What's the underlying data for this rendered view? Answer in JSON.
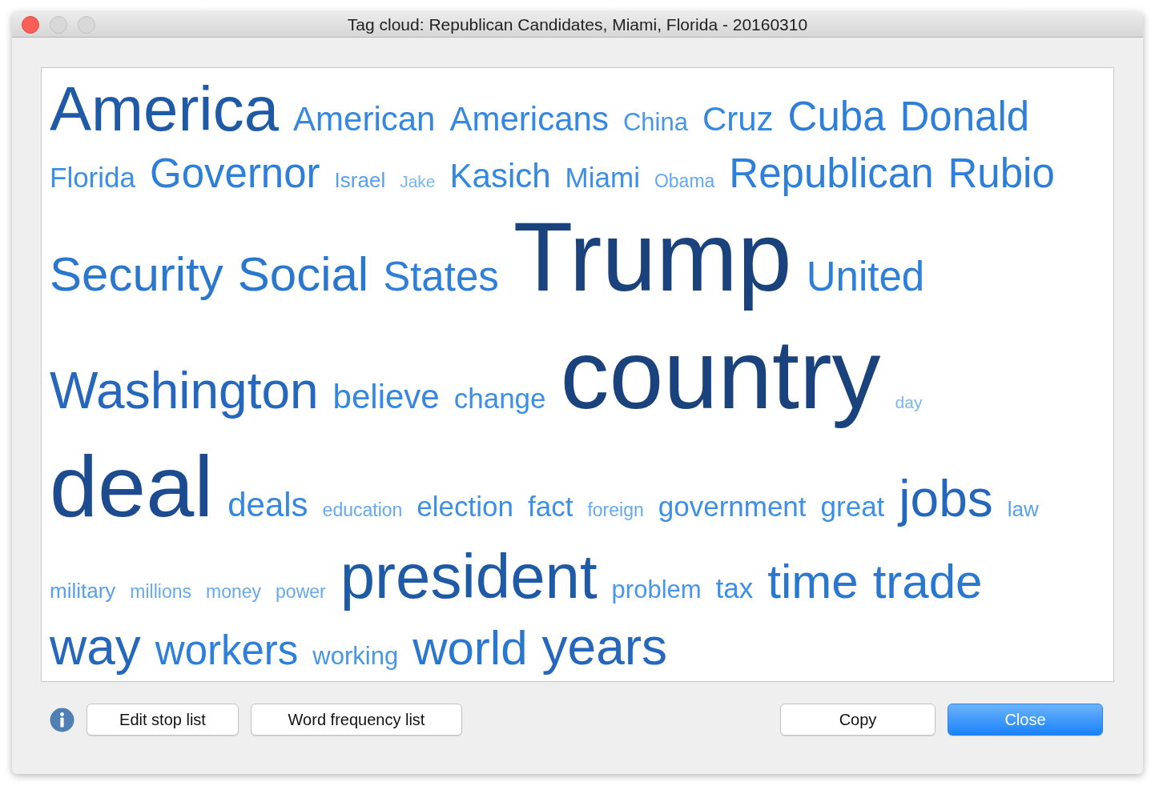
{
  "window": {
    "title": "Tag cloud: Republican Candidates, Miami, Florida - 20160310"
  },
  "cloud": {
    "lines": [
      {
        "words": [
          {
            "text": "America",
            "kind": "t10"
          },
          {
            "text": "American",
            "kind": "t6"
          },
          {
            "text": "Americans",
            "kind": "t6"
          },
          {
            "text": "China",
            "kind": "t4"
          },
          {
            "text": "Cruz",
            "kind": "t6"
          },
          {
            "text": "Cuba",
            "kind": "t7"
          },
          {
            "text": "Donald",
            "kind": "t7"
          }
        ]
      },
      {
        "words": [
          {
            "text": "Florida",
            "kind": "t5"
          },
          {
            "text": "Governor",
            "kind": "t7"
          },
          {
            "text": "Israel",
            "kind": "t3"
          },
          {
            "text": "Jake",
            "kind": "t1"
          },
          {
            "text": "Kasich",
            "kind": "t6"
          },
          {
            "text": "Miami",
            "kind": "t5"
          },
          {
            "text": "Obama",
            "kind": "t2"
          },
          {
            "text": "Republican",
            "kind": "t7"
          },
          {
            "text": "Rubio",
            "kind": "t7"
          }
        ]
      },
      {
        "words": [
          {
            "text": "Security",
            "kind": "t8"
          },
          {
            "text": "Social",
            "kind": "t8"
          },
          {
            "text": "States",
            "kind": "t7"
          },
          {
            "text": "Trump",
            "kind": "t12"
          },
          {
            "text": "United",
            "kind": "t7"
          }
        ]
      },
      {
        "words": [
          {
            "text": "Washington",
            "kind": "t9"
          },
          {
            "text": "believe",
            "kind": "t6"
          },
          {
            "text": "change",
            "kind": "t5"
          },
          {
            "text": "country",
            "kind": "t12"
          },
          {
            "text": "day",
            "kind": "t1"
          }
        ]
      },
      {
        "words": [
          {
            "text": "deal",
            "kind": "t11"
          },
          {
            "text": "deals",
            "kind": "t6"
          },
          {
            "text": "education",
            "kind": "t2"
          },
          {
            "text": "election",
            "kind": "t5"
          },
          {
            "text": "fact",
            "kind": "t5"
          },
          {
            "text": "foreign",
            "kind": "t2"
          },
          {
            "text": "government",
            "kind": "t5"
          },
          {
            "text": "great",
            "kind": "t5"
          },
          {
            "text": "jobs",
            "kind": "t9"
          },
          {
            "text": "law",
            "kind": "t3"
          }
        ]
      },
      {
        "words": [
          {
            "text": "military",
            "kind": "t3"
          },
          {
            "text": "millions",
            "kind": "t2"
          },
          {
            "text": "money",
            "kind": "t2"
          },
          {
            "text": "power",
            "kind": "t2"
          },
          {
            "text": "president",
            "kind": "t10"
          },
          {
            "text": "problem",
            "kind": "t4"
          },
          {
            "text": "tax",
            "kind": "t5"
          },
          {
            "text": "time",
            "kind": "t8"
          },
          {
            "text": "trade",
            "kind": "t8"
          }
        ]
      },
      {
        "words": [
          {
            "text": "way",
            "kind": "t9"
          },
          {
            "text": "workers",
            "kind": "t7"
          },
          {
            "text": "working",
            "kind": "t4"
          },
          {
            "text": "world",
            "kind": "t8"
          },
          {
            "text": "years",
            "kind": "t9"
          }
        ]
      }
    ]
  },
  "buttons_left": [
    {
      "label": "Edit stop list",
      "default": false
    },
    {
      "label": "Word frequency list",
      "default": false
    }
  ],
  "buttons_right": [
    {
      "label": "Copy",
      "default": false
    },
    {
      "label": "Close",
      "default": true
    }
  ]
}
